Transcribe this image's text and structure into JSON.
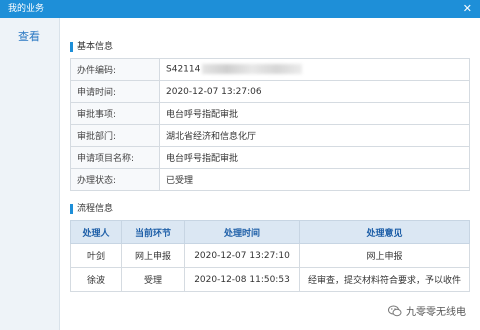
{
  "window": {
    "title": "我的业务",
    "close_glyph": "✕"
  },
  "sidebar": {
    "items": [
      {
        "label": "查看"
      }
    ]
  },
  "basic": {
    "title": "基本信息",
    "rows": [
      {
        "label": "办件编码:",
        "value": "S42114"
      },
      {
        "label": "申请时间:",
        "value": "2020-12-07 13:27:06"
      },
      {
        "label": "审批事项:",
        "value": "电台呼号指配审批"
      },
      {
        "label": "审批部门:",
        "value": "湖北省经济和信息化厅"
      },
      {
        "label": "申请项目名称:",
        "value": "电台呼号指配审批"
      },
      {
        "label": "办理状态:",
        "value": "已受理"
      }
    ]
  },
  "process": {
    "title": "流程信息",
    "headers": [
      "处理人",
      "当前环节",
      "处理时间",
      "处理意见"
    ],
    "rows": [
      [
        "叶剑",
        "网上申报",
        "2020-12-07 13:27:10",
        "网上申报"
      ],
      [
        "徐波",
        "受理",
        "2020-12-08 11:50:53",
        "经审查，提交材料符合要求，予以收件"
      ]
    ]
  },
  "watermark": {
    "text": "九零零无线电",
    "icon": "wechat-icon"
  },
  "colors": {
    "accent": "#1e8fd8",
    "header_bg": "#dbe7f3",
    "header_text": "#1e5fa8"
  }
}
